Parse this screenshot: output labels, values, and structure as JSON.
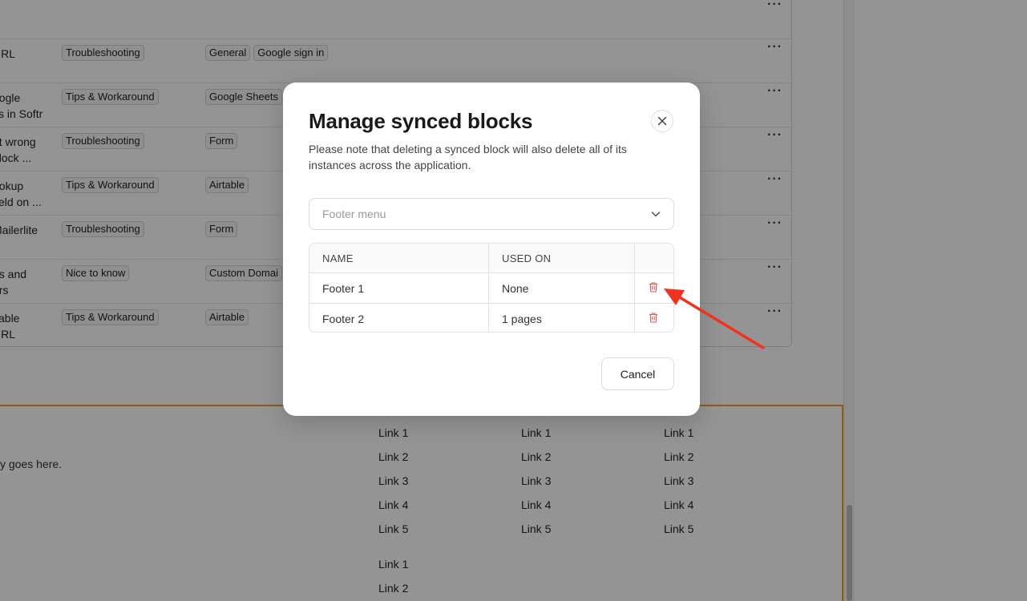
{
  "background": {
    "rows": [
      {
        "title": "",
        "category": "",
        "tags": []
      },
      {
        "title": "URL",
        "category": "Troubleshooting",
        "tags": [
          "General",
          "Google sign in"
        ]
      },
      {
        "title": "oogle\nks in Softr",
        "category": "Tips & Workaround",
        "tags": [
          "Google Sheets"
        ]
      },
      {
        "title": "nt wrong\nblock ...",
        "category": "Troubleshooting",
        "tags": [
          "Form"
        ]
      },
      {
        "title": "ookup\nfield on ...",
        "category": "Tips & Workaround",
        "tags": [
          "Airtable"
        ]
      },
      {
        "title": "Mailerlite",
        "category": "Troubleshooting",
        "tags": [
          "Form"
        ]
      },
      {
        "title": "ns and\ners",
        "category": "Nice to know",
        "tags": [
          "Custom Domai"
        ]
      },
      {
        "title": "itable\n URL",
        "category": "Tips & Workaround",
        "tags": [
          "Airtable"
        ]
      }
    ],
    "row_menu": "···",
    "footer_copy": "y goes here.",
    "link_columns": [
      [
        "Link 1",
        "Link 2",
        "Link 3",
        "Link 4",
        "Link 5"
      ],
      [
        "Link 1",
        "Link 2",
        "Link 3",
        "Link 4",
        "Link 5"
      ],
      [
        "Link 1",
        "Link 2",
        "Link 3",
        "Link 4",
        "Link 5"
      ],
      [
        "Link 1",
        "Link 2"
      ]
    ]
  },
  "modal": {
    "title": "Manage synced blocks",
    "description": "Please note that deleting a synced block will also delete all of its instances across the application.",
    "select": {
      "value": "Footer menu"
    },
    "table": {
      "headers": {
        "name": "NAME",
        "used_on": "USED ON"
      },
      "rows": [
        {
          "name": "Footer 1",
          "used_on": "None"
        },
        {
          "name": "Footer 2",
          "used_on": "1 pages"
        }
      ]
    },
    "cancel_label": "Cancel"
  },
  "colors": {
    "overlay": "#00000069",
    "delete_icon": "#e25555",
    "annotation_arrow": "#f0321e",
    "footer_border": "#f59e2b"
  },
  "icons": {
    "close": "close-icon",
    "chevron": "chevron-down-icon",
    "delete": "trash-icon",
    "annotation": "arrow-annotation-icon"
  }
}
